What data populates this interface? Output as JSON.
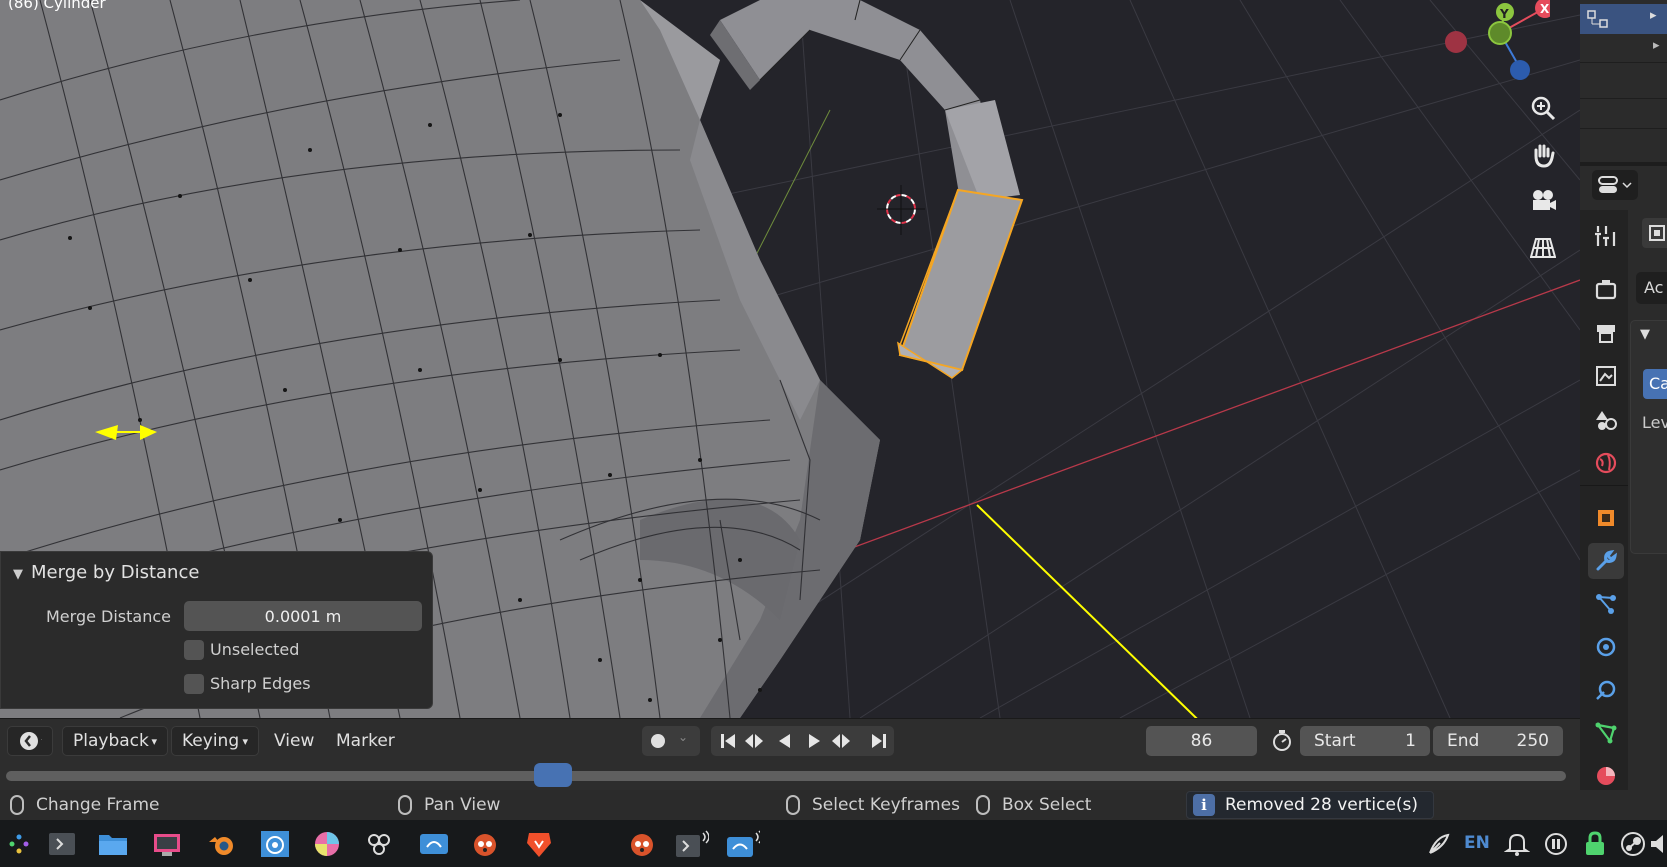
{
  "viewport": {
    "object_label": "(86) Cylinder"
  },
  "operator_panel": {
    "title": "Merge by Distance",
    "merge_distance_label": "Merge Distance",
    "merge_distance_value": "0.0001 m",
    "unselected_label": "Unselected",
    "unselected_checked": false,
    "sharp_edges_label": "Sharp Edges",
    "sharp_edges_checked": false
  },
  "properties_strip": {
    "partial_texts": [
      "Ac",
      "Ca",
      "Lev"
    ]
  },
  "timeline": {
    "menus": [
      "Playback",
      "Keying"
    ],
    "plain_menus": [
      "View",
      "Marker"
    ],
    "current_frame": "86",
    "start_label": "Start",
    "start_value": "1",
    "end_label": "End",
    "end_value": "250"
  },
  "status_bar": {
    "left_action": "Change Frame",
    "middle_action": "Pan View",
    "right_action_1": "Select Keyframes",
    "right_action_2": "Box Select",
    "report": "Removed 28 vertice(s)"
  },
  "taskbar": {
    "language": "EN"
  },
  "colors": {
    "accent": "#4772b3",
    "selection_orange": "#f5a623",
    "axis_x": "#e54c5c",
    "axis_y": "#8cc63f",
    "axis_z": "#3e7ad8",
    "annotation": "#ffff00"
  }
}
